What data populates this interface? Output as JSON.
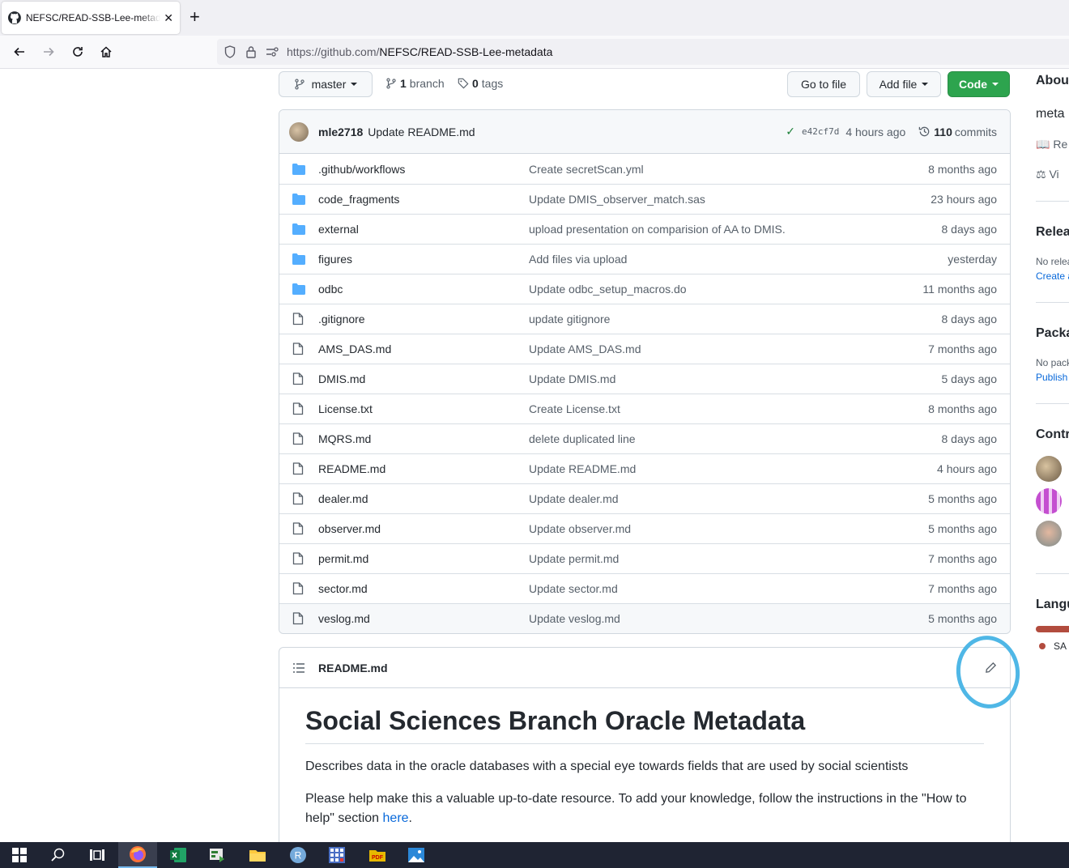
{
  "browser": {
    "tab_title": "NEFSC/READ-SSB-Lee-metadata",
    "url_prefix": "https://github.com/",
    "url_path": "NEFSC/READ-SSB-Lee-metadata"
  },
  "repo_nav": {
    "branch_name": "master",
    "branch_count": "1",
    "branch_label": "branch",
    "tag_count": "0",
    "tag_label": "tags",
    "go_to_file": "Go to file",
    "add_file": "Add file",
    "code": "Code"
  },
  "commit": {
    "author": "mle2718",
    "message": "Update README.md",
    "sha": "e42cf7d",
    "time": "4 hours ago",
    "count": "110",
    "count_label": "commits"
  },
  "files": [
    {
      "name": ".github/workflows",
      "type": "folder",
      "message": "Create secretScan.yml",
      "age": "8 months ago"
    },
    {
      "name": "code_fragments",
      "type": "folder",
      "message": "Update DMIS_observer_match.sas",
      "age": "23 hours ago"
    },
    {
      "name": "external",
      "type": "folder",
      "message": "upload presentation on comparision of AA to DMIS.",
      "age": "8 days ago"
    },
    {
      "name": "figures",
      "type": "folder",
      "message": "Add files via upload",
      "age": "yesterday"
    },
    {
      "name": "odbc",
      "type": "folder",
      "message": "Update odbc_setup_macros.do",
      "age": "11 months ago"
    },
    {
      "name": ".gitignore",
      "type": "file",
      "message": "update gitignore",
      "age": "8 days ago"
    },
    {
      "name": "AMS_DAS.md",
      "type": "file",
      "message": "Update AMS_DAS.md",
      "age": "7 months ago"
    },
    {
      "name": "DMIS.md",
      "type": "file",
      "message": "Update DMIS.md",
      "age": "5 days ago"
    },
    {
      "name": "License.txt",
      "type": "file",
      "message": "Create License.txt",
      "age": "8 months ago"
    },
    {
      "name": "MQRS.md",
      "type": "file",
      "message": "delete duplicated line",
      "age": "8 days ago"
    },
    {
      "name": "README.md",
      "type": "file",
      "message": "Update README.md",
      "age": "4 hours ago"
    },
    {
      "name": "dealer.md",
      "type": "file",
      "message": "Update dealer.md",
      "age": "5 months ago"
    },
    {
      "name": "observer.md",
      "type": "file",
      "message": "Update observer.md",
      "age": "5 months ago"
    },
    {
      "name": "permit.md",
      "type": "file",
      "message": "Update permit.md",
      "age": "7 months ago"
    },
    {
      "name": "sector.md",
      "type": "file",
      "message": "Update sector.md",
      "age": "7 months ago"
    },
    {
      "name": "veslog.md",
      "type": "file",
      "message": "Update veslog.md",
      "age": "5 months ago"
    }
  ],
  "readme": {
    "filename": "README.md",
    "title": "Social Sciences Branch Oracle Metadata",
    "para1": "Describes data in the oracle databases with a special eye towards fields that are used by social scientists",
    "para2": "Please help make this a valuable up-to-date resource. To add your knowledge, follow the instructions in the \"How to help\" section ",
    "para2_link": "here",
    "para2_end": "."
  },
  "sidebar": {
    "about": "Abou",
    "desc": "meta",
    "readme_link": "Re",
    "license_link": "Vi",
    "releases": "Releas",
    "no_releases": "No relea",
    "create_release": "Create a",
    "packages": "Packa",
    "no_packages": "No pack",
    "publish": "Publish",
    "contributors": "Contr",
    "languages": "Langu",
    "lang_name": "SA",
    "lang_color": "#b24c3e"
  },
  "colors": {
    "accent_green": "#2da44e",
    "link_blue": "#0969da",
    "folder_blue": "#54aeff",
    "annotation_circle": "#4fb7e6"
  },
  "taskbar": {
    "icons": [
      "windows-start-icon",
      "search-icon",
      "task-view-icon",
      "firefox-icon",
      "excel-icon",
      "project-icon",
      "file-explorer-icon",
      "r-icon",
      "calculator-icon",
      "pdf-icon",
      "photos-icon"
    ],
    "r_label": "R",
    "pdf_label": "PDF"
  }
}
